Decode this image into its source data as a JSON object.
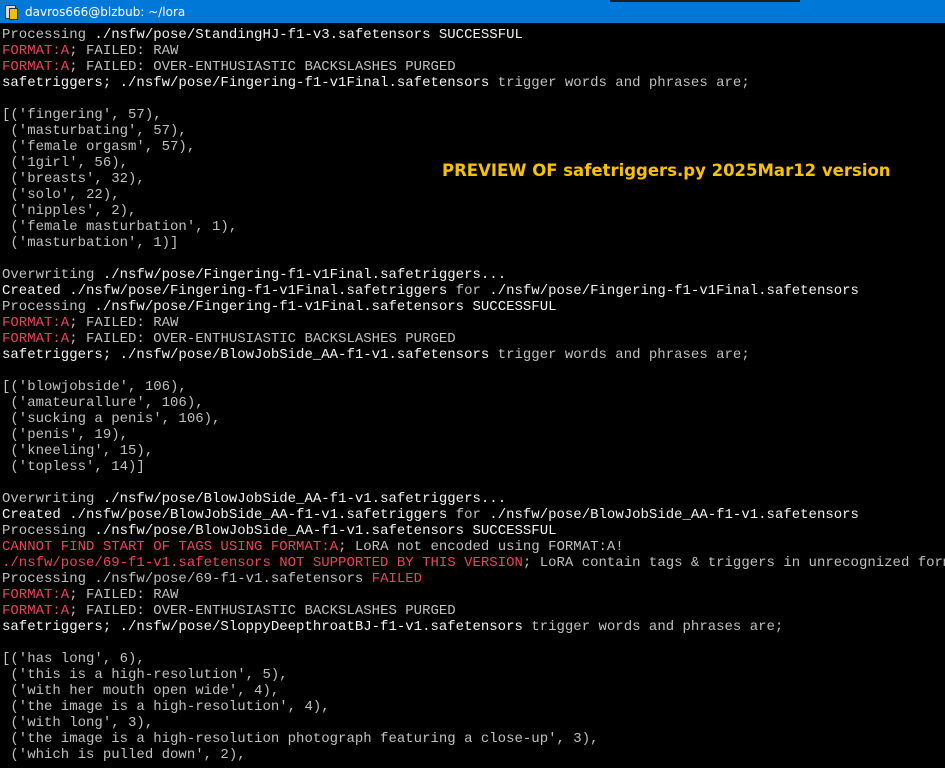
{
  "window": {
    "title": "davros666@blzbub: ~/lora",
    "icon": "putty-icon"
  },
  "overlay_text": "PREVIEW OF safetriggers.py 2025Mar12 version",
  "lines": [
    {
      "segs": [
        {
          "t": "Processing ",
          "c": "g"
        },
        {
          "t": "./nsfw/pose/StandingHJ-f1-v3.safetensors SUCCESSFUL",
          "c": "w"
        }
      ]
    },
    {
      "segs": [
        {
          "t": "FORMAT:A",
          "c": "r"
        },
        {
          "t": "; FAILED: RAW",
          "c": "g"
        }
      ]
    },
    {
      "segs": [
        {
          "t": "FORMAT:A",
          "c": "r"
        },
        {
          "t": "; FAILED: OVER-ENTHUSIASTIC BACKSLASHES PURGED",
          "c": "g"
        }
      ]
    },
    {
      "segs": [
        {
          "t": "safetriggers; ./nsfw/pose/Fingering-f1-v1Final.safetensors",
          "c": "w"
        },
        {
          "t": " trigger words and phrases are;",
          "c": "g"
        }
      ]
    },
    {
      "segs": [
        {
          "t": " ",
          "c": "g"
        }
      ]
    },
    {
      "segs": [
        {
          "t": "[('fingering', 57),",
          "c": "g"
        }
      ]
    },
    {
      "segs": [
        {
          "t": " ('masturbating', 57),",
          "c": "g"
        }
      ]
    },
    {
      "segs": [
        {
          "t": " ('female orgasm', 57),",
          "c": "g"
        }
      ]
    },
    {
      "segs": [
        {
          "t": " ('1girl', 56),",
          "c": "g"
        }
      ]
    },
    {
      "segs": [
        {
          "t": " ('breasts', 32),",
          "c": "g"
        }
      ]
    },
    {
      "segs": [
        {
          "t": " ('solo', 22),",
          "c": "g"
        }
      ]
    },
    {
      "segs": [
        {
          "t": " ('nipples', 2),",
          "c": "g"
        }
      ]
    },
    {
      "segs": [
        {
          "t": " ('female masturbation', 1),",
          "c": "g"
        }
      ]
    },
    {
      "segs": [
        {
          "t": " ('masturbation', 1)]",
          "c": "g"
        }
      ]
    },
    {
      "segs": [
        {
          "t": " ",
          "c": "g"
        }
      ]
    },
    {
      "segs": [
        {
          "t": "Overwriting ",
          "c": "g"
        },
        {
          "t": "./nsfw/pose/Fingering-f1-v1Final.safetriggers...",
          "c": "w"
        }
      ]
    },
    {
      "segs": [
        {
          "t": "Created ./nsfw/pose/Fingering-f1-v1Final.safetriggers",
          "c": "w"
        },
        {
          "t": " for ",
          "c": "g"
        },
        {
          "t": "./nsfw/pose/Fingering-f1-v1Final.safetensors",
          "c": "w"
        }
      ]
    },
    {
      "segs": [
        {
          "t": "Processing ",
          "c": "g"
        },
        {
          "t": "./nsfw/pose/Fingering-f1-v1Final.safetensors SUCCESSFUL",
          "c": "w"
        }
      ]
    },
    {
      "segs": [
        {
          "t": "FORMAT:A",
          "c": "r"
        },
        {
          "t": "; FAILED: RAW",
          "c": "g"
        }
      ]
    },
    {
      "segs": [
        {
          "t": "FORMAT:A",
          "c": "r"
        },
        {
          "t": "; FAILED: OVER-ENTHUSIASTIC BACKSLASHES PURGED",
          "c": "g"
        }
      ]
    },
    {
      "segs": [
        {
          "t": "safetriggers; ./nsfw/pose/BlowJobSide_AA-f1-v1.safetensors",
          "c": "w"
        },
        {
          "t": " trigger words and phrases are;",
          "c": "g"
        }
      ]
    },
    {
      "segs": [
        {
          "t": " ",
          "c": "g"
        }
      ]
    },
    {
      "segs": [
        {
          "t": "[('blowjobside', 106),",
          "c": "g"
        }
      ]
    },
    {
      "segs": [
        {
          "t": " ('amateurallure', 106),",
          "c": "g"
        }
      ]
    },
    {
      "segs": [
        {
          "t": " ('sucking a penis', 106),",
          "c": "g"
        }
      ]
    },
    {
      "segs": [
        {
          "t": " ('penis', 19),",
          "c": "g"
        }
      ]
    },
    {
      "segs": [
        {
          "t": " ('kneeling', 15),",
          "c": "g"
        }
      ]
    },
    {
      "segs": [
        {
          "t": " ('topless', 14)]",
          "c": "g"
        }
      ]
    },
    {
      "segs": [
        {
          "t": " ",
          "c": "g"
        }
      ]
    },
    {
      "segs": [
        {
          "t": "Overwriting ",
          "c": "g"
        },
        {
          "t": "./nsfw/pose/BlowJobSide_AA-f1-v1.safetriggers...",
          "c": "w"
        }
      ]
    },
    {
      "segs": [
        {
          "t": "Created ./nsfw/pose/BlowJobSide_AA-f1-v1.safetriggers",
          "c": "w"
        },
        {
          "t": " for ",
          "c": "g"
        },
        {
          "t": "./nsfw/pose/BlowJobSide_AA-f1-v1.safetensors",
          "c": "w"
        }
      ]
    },
    {
      "segs": [
        {
          "t": "Processing ",
          "c": "g"
        },
        {
          "t": "./nsfw/pose/BlowJobSide_AA-f1-v1.safetensors SUCCESSFUL",
          "c": "w"
        }
      ]
    },
    {
      "segs": [
        {
          "t": "CANNOT FIND START OF TAGS USING FORMAT:A",
          "c": "r"
        },
        {
          "t": "; LoRA not encoded using FORMAT:A!",
          "c": "g"
        }
      ]
    },
    {
      "segs": [
        {
          "t": "./nsfw/pose/69-f1-v1.safetensors NOT SUPPORTED BY THIS VERSION",
          "c": "r"
        },
        {
          "t": "; LoRA contain tags & triggers in unrecognized format!",
          "c": "g"
        }
      ]
    },
    {
      "segs": [
        {
          "t": "Processing ./nsfw/pose/69-f1-v1.safetensors ",
          "c": "g"
        },
        {
          "t": "FAILED",
          "c": "r"
        }
      ]
    },
    {
      "segs": [
        {
          "t": "FORMAT:A",
          "c": "r"
        },
        {
          "t": "; FAILED: RAW",
          "c": "g"
        }
      ]
    },
    {
      "segs": [
        {
          "t": "FORMAT:A",
          "c": "r"
        },
        {
          "t": "; FAILED: OVER-ENTHUSIASTIC BACKSLASHES PURGED",
          "c": "g"
        }
      ]
    },
    {
      "segs": [
        {
          "t": "safetriggers; ./nsfw/pose/SloppyDeepthroatBJ-f1-v1.safetensors",
          "c": "w"
        },
        {
          "t": " trigger words and phrases are;",
          "c": "g"
        }
      ]
    },
    {
      "segs": [
        {
          "t": " ",
          "c": "g"
        }
      ]
    },
    {
      "segs": [
        {
          "t": "[('has long', 6),",
          "c": "g"
        }
      ]
    },
    {
      "segs": [
        {
          "t": " ('this is a high-resolution', 5),",
          "c": "g"
        }
      ]
    },
    {
      "segs": [
        {
          "t": " ('with her mouth open wide', 4),",
          "c": "g"
        }
      ]
    },
    {
      "segs": [
        {
          "t": " ('the image is a high-resolution', 4),",
          "c": "g"
        }
      ]
    },
    {
      "segs": [
        {
          "t": " ('with long', 3),",
          "c": "g"
        }
      ]
    },
    {
      "segs": [
        {
          "t": " ('the image is a high-resolution photograph featuring a close-up', 3),",
          "c": "g"
        }
      ]
    },
    {
      "segs": [
        {
          "t": " ('which is pulled down', 2),",
          "c": "g"
        }
      ]
    }
  ]
}
